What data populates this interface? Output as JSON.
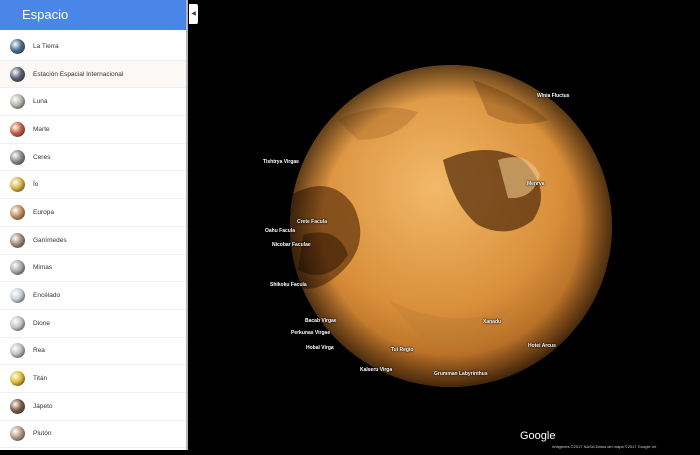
{
  "sidebar": {
    "title": "Espacio",
    "collapse_icon": "chevron-left-icon",
    "items": [
      {
        "label": "La Tierra",
        "thumb": "#4b6e8c"
      },
      {
        "label": "Estación Espacial Internacional",
        "thumb": "#56606e"
      },
      {
        "label": "Luna",
        "thumb": "#b9b4ae"
      },
      {
        "label": "Marte",
        "thumb": "#c0603c"
      },
      {
        "label": "Ceres",
        "thumb": "#8f8a85"
      },
      {
        "label": "Ío",
        "thumb": "#d8b347"
      },
      {
        "label": "Europa",
        "thumb": "#c2905c"
      },
      {
        "label": "Ganímedes",
        "thumb": "#9e8978"
      },
      {
        "label": "Mimas",
        "thumb": "#a9a9a9"
      },
      {
        "label": "Encélado",
        "thumb": "#c8d0d6"
      },
      {
        "label": "Dione",
        "thumb": "#c4c4c4"
      },
      {
        "label": "Rea",
        "thumb": "#bdbdbd"
      },
      {
        "label": "Titán",
        "thumb": "#e0b92e"
      },
      {
        "label": "Jápeto",
        "thumb": "#7b5b45"
      },
      {
        "label": "Plutón",
        "thumb": "#b59a88"
      }
    ]
  },
  "map": {
    "labels": [
      "Winia Fluctus",
      "Tishtrya Virgae",
      "Menrva",
      "Crete Facula",
      "Oahu Facula",
      "Nicobar Faculae",
      "Shikoku Facula",
      "Bacab Virgae",
      "Perkunas Virgae",
      "Xanadu",
      "Hobal Virga",
      "Tui Regio",
      "Hotei Arcus",
      "Kalseru Virga",
      "Grumman Labyrinthus"
    ],
    "logo": "Google",
    "attribution": "Imágenes ©2017 NASA,Datos del mapa ©2017 Google,Inf"
  },
  "colors": {
    "header": "#4a86e8",
    "planet_light": "#e8a24c",
    "planet_dark": "#8a4a14"
  }
}
